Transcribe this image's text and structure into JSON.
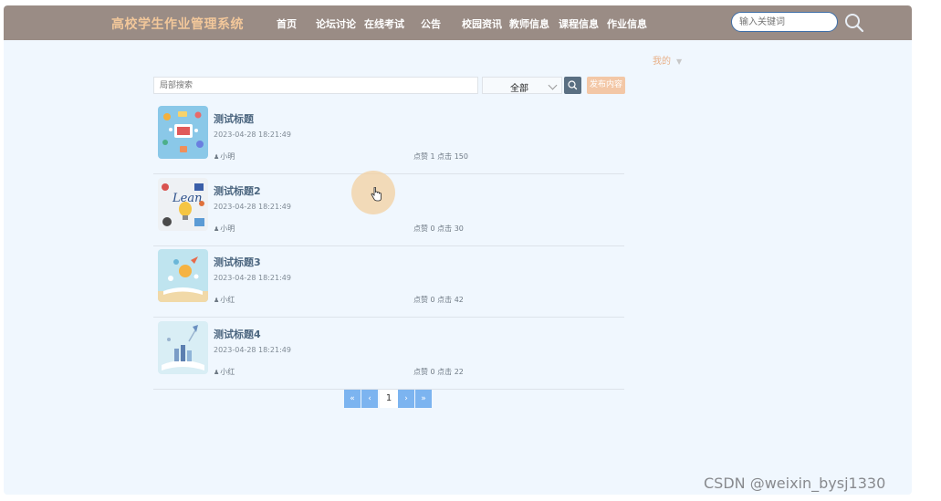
{
  "app": {
    "title": "高校学生作业管理系统"
  },
  "nav": {
    "items": [
      {
        "label": "首页"
      },
      {
        "label": "论坛讨论"
      },
      {
        "label": "在线考试"
      },
      {
        "label": "公告"
      },
      {
        "label": "校园资讯"
      },
      {
        "label": "教师信息"
      },
      {
        "label": "课程信息"
      },
      {
        "label": "作业信息"
      }
    ]
  },
  "top_search": {
    "placeholder": "输入关键词",
    "icon": "search-icon"
  },
  "user_menu": {
    "label": "我的",
    "icon": "chevron-down-icon"
  },
  "toolbar": {
    "search_placeholder": "局部搜索",
    "category_selected": "全部",
    "search_icon": "search-icon",
    "publish_label": "发布内容"
  },
  "posts": [
    {
      "title": "测试标题",
      "date": "2023-04-28 18:21:49",
      "author": "小明",
      "stats": "点赞 1 点击 150"
    },
    {
      "title": "测试标题2",
      "date": "2023-04-28 18:21:49",
      "author": "小明",
      "stats": "点赞 0 点击 30"
    },
    {
      "title": "测试标题3",
      "date": "2023-04-28 18:21:49",
      "author": "小红",
      "stats": "点赞 0 点击 42"
    },
    {
      "title": "测试标题4",
      "date": "2023-04-28 18:21:49",
      "author": "小红",
      "stats": "点赞 0 点击 22"
    }
  ],
  "pagination": {
    "first": "«",
    "prev": "‹",
    "current": "1",
    "next": "›",
    "last": "»"
  },
  "colors": {
    "topbar": "#9a8c85",
    "brand": "#f2c79a",
    "accent": "#7cb4f0",
    "publish": "#f3c7a6"
  },
  "watermark": "CSDN @weixin_bysj1330"
}
